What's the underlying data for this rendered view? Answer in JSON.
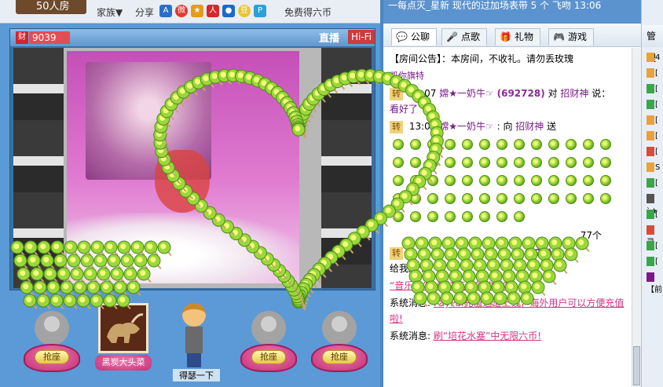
{
  "top_bar": {
    "room_count": "50人房",
    "family_menu": "家族▼",
    "share_label": "分享",
    "free_coins": "免费得六币"
  },
  "video": {
    "host_badge": "财",
    "host_id": "9039",
    "live_label": "直播",
    "hifi_label": "Hi-Fi"
  },
  "seats": {
    "grab_label": "抢座",
    "bull_name": "黑炭大头菜",
    "character_label": "得瑟一下"
  },
  "right_top": {
    "partial_text": "一每点灭_星新 现代的过加场表带 5 个 飞吻 13:06"
  },
  "chat_tabs": [
    {
      "label": "公聊",
      "icon": "chat-bubble-icon"
    },
    {
      "label": "点歌",
      "icon": "microphone-icon"
    },
    {
      "label": "礼物",
      "icon": "gift-icon"
    },
    {
      "label": "游戏",
      "icon": "gamepad-icon"
    }
  ],
  "chat": {
    "notice_tag": "【房间公告】",
    "notice_text": "：本房间，不收礼。请勿丢玫瑰",
    "partial_top": "凯你旗特",
    "msg1": {
      "badge": "转",
      "time": "13:07",
      "user": "嫦★一奶牛☞",
      "uid": "(692728)",
      "verb": "对",
      "target": "招财神",
      "verb2": "说：",
      "text": "看好了"
    },
    "msg2": {
      "badge": "转",
      "time": "13:07",
      "user": "嫦★一奶牛☞",
      "verb": ": 向",
      "target": "招财神",
      "verb2": "送"
    },
    "gift_count": "77个",
    "msg3": {
      "badge": "转",
      "time": "7",
      "uid_tail": "728)",
      "text": "给我加个"
    },
    "sys1": {
      "label": "系统消息:",
      "text": "“音乐盒”中畅快连续的收听吧!"
    },
    "sys2": {
      "label": "系统消息:",
      "link": "PayPal充值通道上线，海外用户可以方便充值啦!"
    },
    "sys3": {
      "label": "系统消息:",
      "link": "刷“培花水塞”中无限六币!"
    }
  },
  "admin": {
    "title": "管理",
    "rows": [
      "4",
      "[",
      "[",
      "[",
      "[",
      "[",
      "[",
      "S",
      "[",
      "`★",
      "[",
      "灵",
      "[",
      "[",
      "【前"
    ]
  },
  "colors": {
    "lollipop_green": "#9ad73a",
    "lollipop_yellow": "#f4ff7a",
    "pink_seat": "#c42f76",
    "system_link": "#d63384",
    "uid_purple": "#8a2a9a"
  }
}
